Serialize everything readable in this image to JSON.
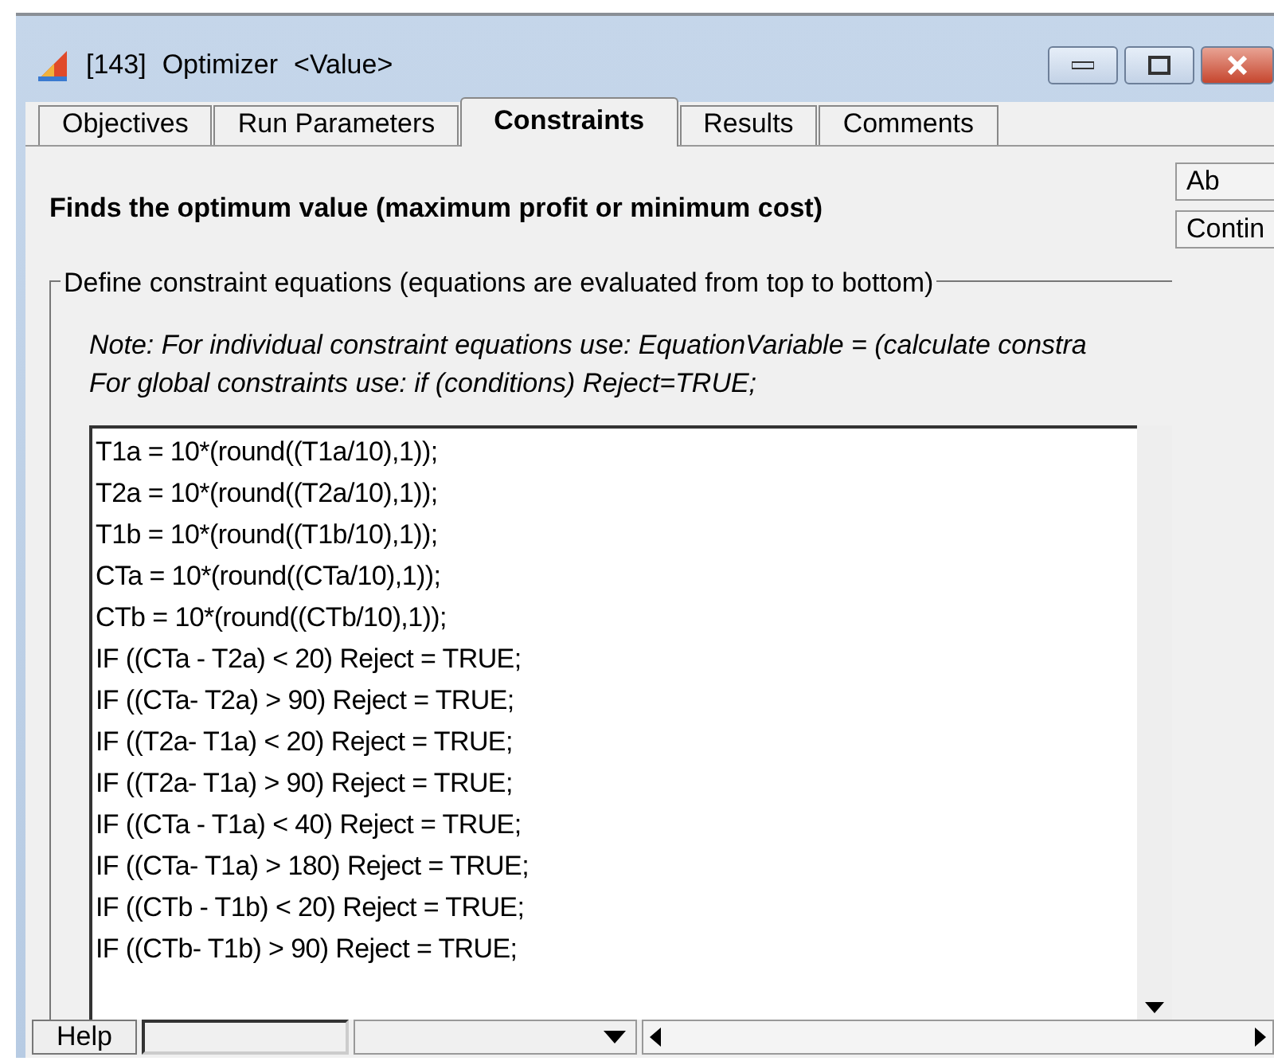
{
  "window": {
    "title_id": "[143]",
    "title": "Optimizer",
    "title_value": "<Value>"
  },
  "tabs": [
    {
      "label": "Objectives",
      "selected": false
    },
    {
      "label": "Run Parameters",
      "selected": false
    },
    {
      "label": "Constraints",
      "selected": true
    },
    {
      "label": "Results",
      "selected": false
    },
    {
      "label": "Comments",
      "selected": false
    }
  ],
  "description": "Finds the optimum value (maximum profit or minimum cost)",
  "side_buttons": [
    "Ab",
    "Contin"
  ],
  "group": {
    "title": "Define constraint equations (equations are evaluated from top to bottom)",
    "note_lines": [
      "Note: For individual constraint equations use: EquationVariable = (calculate constra",
      "For global constraints use: if (conditions) Reject=TRUE;"
    ],
    "equations": [
      "T1a = 10*(round((T1a/10),1));",
      "T2a = 10*(round((T2a/10),1));",
      "T1b = 10*(round((T1b/10),1));",
      "CTa = 10*(round((CTa/10),1));",
      "CTb = 10*(round((CTb/10),1));",
      "IF ((CTa - T2a) < 20) Reject = TRUE;",
      "IF ((CTa- T2a) > 90) Reject = TRUE;",
      "IF ((T2a- T1a) < 20) Reject = TRUE;",
      "IF ((T2a- T1a) > 90) Reject = TRUE;",
      "IF ((CTa - T1a) < 40) Reject = TRUE;",
      "IF ((CTa- T1a) > 180) Reject = TRUE;",
      "IF ((CTb - T1b) < 20) Reject = TRUE;",
      "IF ((CTb- T1b) > 90) Reject = TRUE;"
    ]
  },
  "status_bar": {
    "help_button": "Help"
  }
}
